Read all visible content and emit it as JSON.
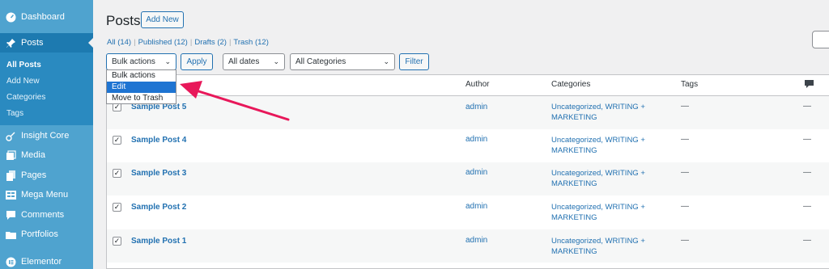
{
  "sidebar": {
    "items": [
      {
        "label": "Dashboard",
        "icon": "dashboard-icon"
      },
      {
        "label": "Posts",
        "icon": "pushpin-icon"
      },
      {
        "label": "Insight Core",
        "icon": "insight-core-icon"
      },
      {
        "label": "Media",
        "icon": "media-icon"
      },
      {
        "label": "Pages",
        "icon": "pages-icon"
      },
      {
        "label": "Mega Menu",
        "icon": "mega-menu-icon"
      },
      {
        "label": "Comments",
        "icon": "comments-icon"
      },
      {
        "label": "Portfolios",
        "icon": "portfolios-icon"
      },
      {
        "label": "Elementor",
        "icon": "elementor-icon"
      }
    ],
    "submenu": [
      "All Posts",
      "Add New",
      "Categories",
      "Tags"
    ]
  },
  "header": {
    "title": "Posts",
    "add_new": "Add New"
  },
  "filters": {
    "all": "All",
    "all_count": "(14)",
    "published": "Published",
    "published_count": "(12)",
    "drafts": "Drafts",
    "drafts_count": "(2)",
    "trash": "Trash",
    "trash_count": "(12)"
  },
  "toolbar": {
    "bulk_actions": "Bulk actions",
    "apply": "Apply",
    "dates": "All dates",
    "categories": "All Categories",
    "filter": "Filter"
  },
  "bulk_dropdown": {
    "options": [
      "Bulk actions",
      "Edit",
      "Move to Trash"
    ],
    "selected": "Edit"
  },
  "table": {
    "columns": {
      "author": "Author",
      "categories": "Categories",
      "tags": "Tags"
    },
    "rows": [
      {
        "title": "Sample Post 5",
        "author": "admin",
        "categories": "Uncategorized, WRITING + MARKETING",
        "tags": "—",
        "comments": "—"
      },
      {
        "title": "Sample Post 4",
        "author": "admin",
        "categories": "Uncategorized, WRITING + MARKETING",
        "tags": "—",
        "comments": "—"
      },
      {
        "title": "Sample Post 3",
        "author": "admin",
        "categories": "Uncategorized, WRITING + MARKETING",
        "tags": "—",
        "comments": "—"
      },
      {
        "title": "Sample Post 2",
        "author": "admin",
        "categories": "Uncategorized, WRITING + MARKETING",
        "tags": "—",
        "comments": "—"
      },
      {
        "title": "Sample Post 1",
        "author": "admin",
        "categories": "Uncategorized, WRITING + MARKETING",
        "tags": "—",
        "comments": "—"
      }
    ]
  },
  "colors": {
    "sidebar_bg": "#4fa3cf",
    "sidebar_active": "#1d7ab0",
    "link": "#2271b1",
    "annotation_arrow": "#e8185a"
  }
}
